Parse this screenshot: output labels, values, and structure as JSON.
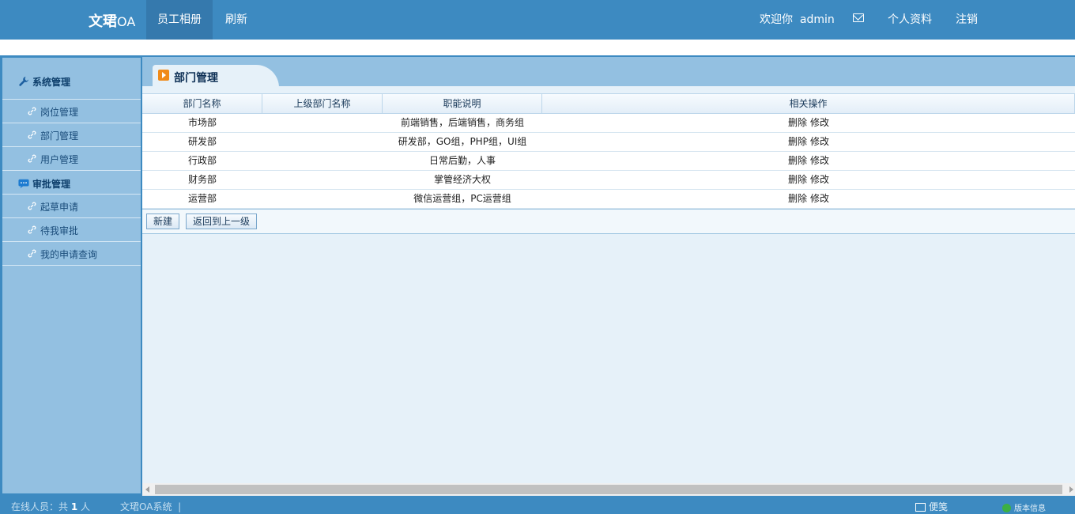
{
  "header": {
    "brand_bold": "文珺",
    "brand_suffix": "OA",
    "nav_album": "员工相册",
    "nav_refresh": "刷新",
    "welcome": "欢迎你  admin",
    "profile": "个人资料",
    "logout": "注销",
    "mail_icon": "envelope-icon"
  },
  "sidebar": {
    "group1": {
      "label": "系统管理",
      "icon": "wrench-icon"
    },
    "group1_items": [
      "岗位管理",
      "部门管理",
      "用户管理"
    ],
    "group2": {
      "label": "审批管理",
      "icon": "chat-icon"
    },
    "group2_items": [
      "起草申请",
      "待我审批",
      "我的申请查询"
    ]
  },
  "page": {
    "title": "部门管理",
    "columns": [
      "部门名称",
      "上级部门名称",
      "职能说明",
      "相关操作"
    ],
    "rows": [
      {
        "name": "市场部",
        "parent": "",
        "desc": "前端销售，后端销售，商务组"
      },
      {
        "name": "研发部",
        "parent": "",
        "desc": "研发部，GO组，PHP组，UI组"
      },
      {
        "name": "行政部",
        "parent": "",
        "desc": "日常后勤，人事"
      },
      {
        "name": "财务部",
        "parent": "",
        "desc": "掌管经济大权"
      },
      {
        "name": "运营部",
        "parent": "",
        "desc": "微信运营组，PC运营组"
      }
    ],
    "op_delete": "删除",
    "op_edit": "修改",
    "btn_new": "新建",
    "btn_back": "返回到上一级"
  },
  "footer": {
    "online_prefix": "在线人员：共",
    "online_count": "1",
    "online_suffix": "人",
    "system": "文珺OA系统  |",
    "note": "便笺",
    "version": "版本信息"
  },
  "colors": {
    "primary": "#3d8ac1",
    "sidebar_bg": "#93c0e1",
    "content_bg": "#e6f1f9",
    "tab_icon": "#f08b1a"
  }
}
